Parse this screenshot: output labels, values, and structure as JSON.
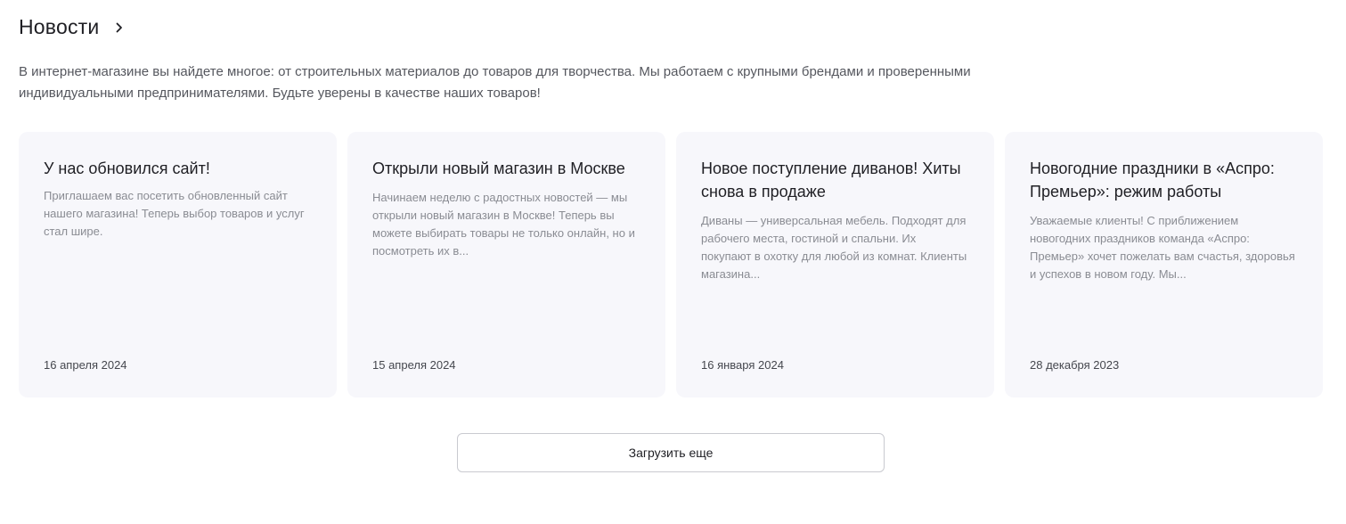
{
  "section": {
    "title": "Новости",
    "arrow_icon": "chevron-right-icon",
    "intro": "В интернет-магазине вы найдете многое: от строительных материалов до товаров для творчества. Мы работаем с крупными брендами и проверенными индивидуальными предпринимателями. Будьте уверены в качестве наших товаров!"
  },
  "news": [
    {
      "title": "У нас обновился сайт!",
      "text": "Приглашаем вас посетить обновленный сайт нашего магазина! Теперь выбор товаров и услуг стал шире.",
      "date": "16 апреля 2024"
    },
    {
      "title": "Открыли новый магазин в Москве",
      "text": "Начинаем неделю с радостных новостей — мы открыли новый магазин в Москве! Теперь вы можете выбирать товары не только онлайн, но и посмотреть их в...",
      "date": "15 апреля 2024"
    },
    {
      "title": "Новое поступление диванов! Хиты снова в продаже",
      "text": "Диваны — универсальная мебель. Подходят для рабочего места, гостиной и спальни. Их покупают в охотку для любой из комнат. Клиенты магазина...",
      "date": "16 января 2024"
    },
    {
      "title": "Новогодние праздники в «Аспро: Премьер»: режим работы",
      "text": "Уважаемые клиенты! С приближением новогодних праздников команда «Аспро: Премьер» хочет пожелать вам счастья, здоровья и успехов в новом году. Мы...",
      "date": "28 декабря 2023"
    }
  ],
  "load_more_label": "Загрузить еще"
}
